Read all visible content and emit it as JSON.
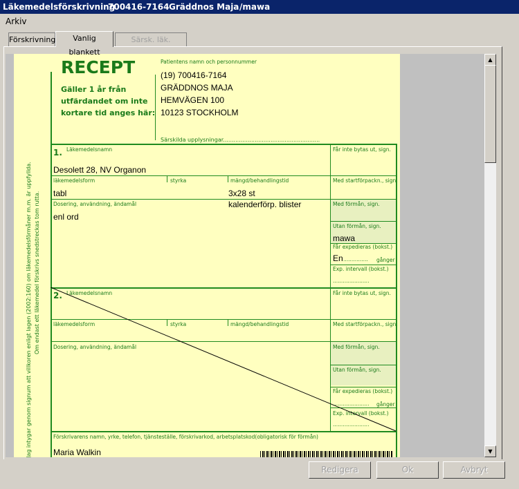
{
  "window": {
    "title_app": "Läkemedelsförskrivning",
    "title_pnr": "700416-7164",
    "title_name": "Gräddnos Maja",
    "title_user": "/mawa"
  },
  "menu": {
    "arkiv": "Arkiv"
  },
  "tabs": [
    "Förskrivning",
    "Vanlig blankett",
    "Särsk. läk. blankett"
  ],
  "form": {
    "recept": "RECEPT",
    "validity": [
      "Gäller 1 år från",
      "utfärdandet om inte",
      "kortare tid anges här:"
    ],
    "patient_label": "Patientens namn och personnummer",
    "patient": [
      "(19) 700416-7164",
      "GRÄDDNOS MAJA",
      "HEMVÄGEN 100",
      "10123 STOCKHOLM"
    ],
    "sarskilda": "Särskilda upplysningar.......................................................",
    "side_text_1": "Jag intygar genom signum att villkoren enligt lagen (2002:160) om läkemedelsförmåner m.m. är uppfyllda.",
    "side_text_2": "Om endast ett läkemedel förskrivs snedstreckas tom rutta.",
    "rx1": {
      "num": "1.",
      "name_label": "Läkemedelsnamn",
      "name": "Desolett 28, NV Organon",
      "form_label": "läkemedelsform",
      "styrka_label": "styrka",
      "mangd_label": "mängd/behandlingstid",
      "form": "tabl",
      "mangd": "3x28 st",
      "mangd2": "kalenderförp. blister",
      "dos_label": "Dosering, användning, ändamål",
      "dos": "enl ord"
    },
    "rx2": {
      "num": "2.",
      "name_label": "Läkemedelsnamn",
      "form_label": "läkemedelsform",
      "styrka_label": "styrka",
      "mangd_label": "mängd/behandlingstid",
      "dos_label": "Dosering, användning, ändamål"
    },
    "side": {
      "byte": "Får inte bytas ut, sign.",
      "start": "Med startförpackn., sign.",
      "med_forman": "Med förmån, sign.",
      "utan_forman": "Utan förmån, sign.",
      "exped": "Får expedieras (bokst.)",
      "ganger": "gånger",
      "interval": "Exp. intervall (bokst.)",
      "utan_val": "mawa",
      "exped_val": "En"
    },
    "forskrivare_label": "Förskrivarens namn, yrke, telefon, tjänsteställe, förskrivarkod, arbetsplatskod(obligatorisk för förmån)",
    "forskrivare": "Maria Walkin"
  },
  "buttons": {
    "redigera": "Redigera",
    "ok": "Ok",
    "avbryt": "Avbryt"
  }
}
